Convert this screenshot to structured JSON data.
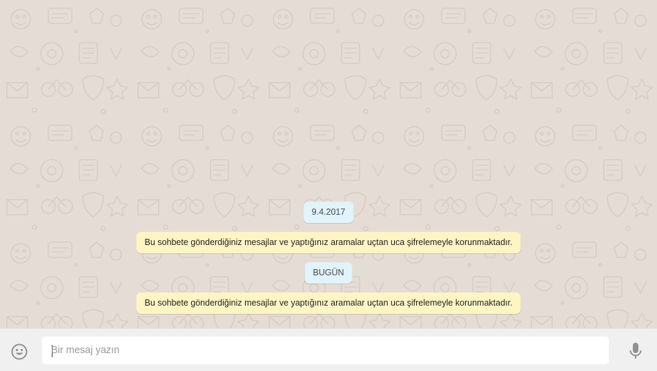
{
  "chat": {
    "date_old": "9.4.2017",
    "encryption_notice_1": "Bu sohbete gönderdiğiniz mesajlar ve yaptığınız aramalar uçtan uca şifrelemeyle korunmaktadır.",
    "date_today": "BUGÜN",
    "encryption_notice_2": "Bu sohbete gönderdiğiniz mesajlar ve yaptığınız aramalar uçtan uca şifrelemeyle korunmaktadır."
  },
  "composer": {
    "placeholder": "Bir mesaj yazın",
    "value": "",
    "emoji_icon": "smiley-icon",
    "mic_icon": "microphone-icon"
  },
  "colors": {
    "chat_background": "#e5ddd5",
    "date_chip": "#e1f3fb",
    "system_message": "#fff5c4",
    "composer_bar": "#f0f0f0",
    "icon_gray": "#919191"
  }
}
